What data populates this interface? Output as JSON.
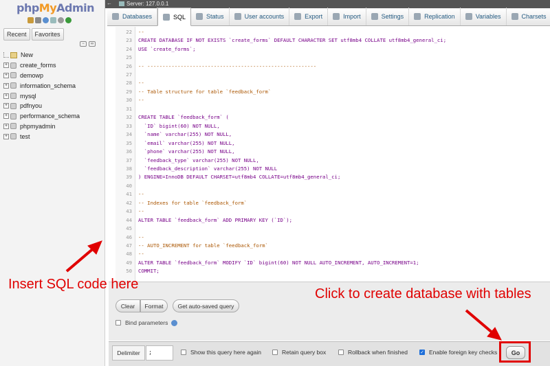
{
  "sidebar": {
    "logo": {
      "php": "php",
      "my": "My",
      "admin": "Admin"
    },
    "tabs": [
      "Recent",
      "Favorites"
    ],
    "tree": [
      {
        "label": "New",
        "type": "new"
      },
      {
        "label": "create_forms",
        "type": "db"
      },
      {
        "label": "demowp",
        "type": "db"
      },
      {
        "label": "information_schema",
        "type": "db"
      },
      {
        "label": "mysql",
        "type": "db"
      },
      {
        "label": "pdfnyou",
        "type": "db"
      },
      {
        "label": "performance_schema",
        "type": "db"
      },
      {
        "label": "phpmyadmin",
        "type": "db"
      },
      {
        "label": "test",
        "type": "db"
      }
    ]
  },
  "topbar": {
    "server": "Server: 127.0.0.1"
  },
  "tabs": [
    {
      "label": "Databases",
      "icon": "database-icon"
    },
    {
      "label": "SQL",
      "icon": "sql-icon",
      "active": true
    },
    {
      "label": "Status",
      "icon": "status-icon"
    },
    {
      "label": "User accounts",
      "icon": "users-icon"
    },
    {
      "label": "Export",
      "icon": "export-icon"
    },
    {
      "label": "Import",
      "icon": "import-icon"
    },
    {
      "label": "Settings",
      "icon": "wrench-icon"
    },
    {
      "label": "Replication",
      "icon": "replication-icon"
    },
    {
      "label": "Variables",
      "icon": "variables-icon"
    },
    {
      "label": "Charsets",
      "icon": "charsets-icon"
    }
  ],
  "editor": {
    "lines": [
      {
        "n": "22",
        "text": "--",
        "kind": "comment"
      },
      {
        "n": "23",
        "text": "CREATE DATABASE IF NOT EXISTS `create_forms` DEFAULT CHARACTER SET utf8mb4 COLLATE utf8mb4_general_ci;",
        "kind": "code"
      },
      {
        "n": "24",
        "text": "USE `create_forms`;",
        "kind": "code"
      },
      {
        "n": "25",
        "text": "",
        "kind": "code"
      },
      {
        "n": "26",
        "text": "-- --------------------------------------------------------",
        "kind": "comment"
      },
      {
        "n": "27",
        "text": "",
        "kind": "code"
      },
      {
        "n": "28",
        "text": "--",
        "kind": "comment"
      },
      {
        "n": "29",
        "text": "-- Table structure for table `feedback_form`",
        "kind": "comment"
      },
      {
        "n": "30",
        "text": "--",
        "kind": "comment"
      },
      {
        "n": "31",
        "text": "",
        "kind": "code"
      },
      {
        "n": "32",
        "text": "CREATE TABLE `feedback_form` (",
        "kind": "code"
      },
      {
        "n": "33",
        "text": "  `ID` bigint(60) NOT NULL,",
        "kind": "code"
      },
      {
        "n": "34",
        "text": "  `name` varchar(255) NOT NULL,",
        "kind": "code"
      },
      {
        "n": "35",
        "text": "  `email` varchar(255) NOT NULL,",
        "kind": "code"
      },
      {
        "n": "36",
        "text": "  `phone` varchar(255) NOT NULL,",
        "kind": "code"
      },
      {
        "n": "37",
        "text": "  `feedback_type` varchar(255) NOT NULL,",
        "kind": "code"
      },
      {
        "n": "38",
        "text": "  `feedback_description` varchar(255) NOT NULL",
        "kind": "code"
      },
      {
        "n": "39",
        "text": ") ENGINE=InnoDB DEFAULT CHARSET=utf8mb4 COLLATE=utf8mb4_general_ci;",
        "kind": "code"
      },
      {
        "n": "40",
        "text": "",
        "kind": "code"
      },
      {
        "n": "41",
        "text": "--",
        "kind": "comment"
      },
      {
        "n": "42",
        "text": "-- Indexes for table `feedback_form`",
        "kind": "comment"
      },
      {
        "n": "43",
        "text": "--",
        "kind": "comment"
      },
      {
        "n": "44",
        "text": "ALTER TABLE `feedback_form` ADD PRIMARY KEY (`ID`);",
        "kind": "code"
      },
      {
        "n": "45",
        "text": "",
        "kind": "code"
      },
      {
        "n": "46",
        "text": "--",
        "kind": "comment"
      },
      {
        "n": "47",
        "text": "-- AUTO_INCREMENT for table `feedback_form`",
        "kind": "comment"
      },
      {
        "n": "48",
        "text": "--",
        "kind": "comment"
      },
      {
        "n": "49",
        "text": "ALTER TABLE `feedback_form` MODIFY `ID` bigint(60) NOT NULL AUTO_INCREMENT, AUTO_INCREMENT=1;",
        "kind": "code"
      },
      {
        "n": "50",
        "text": "COMMIT;",
        "kind": "code"
      }
    ]
  },
  "buttons": {
    "clear": "Clear",
    "format": "Format",
    "autosaved": "Get auto-saved query"
  },
  "bind_parameters": "Bind parameters",
  "bottom": {
    "delimiter_label": "Delimiter",
    "delimiter_value": ";",
    "show_query": "Show this query here again",
    "retain_box": "Retain query box",
    "rollback": "Rollback when finished",
    "foreign_keys": "Enable foreign key checks",
    "go": "Go"
  },
  "annotations": {
    "insert": "Insert SQL code here",
    "click": "Click to create database with tables"
  },
  "colors": {
    "annotation": "#e00000",
    "link": "#235a81"
  }
}
